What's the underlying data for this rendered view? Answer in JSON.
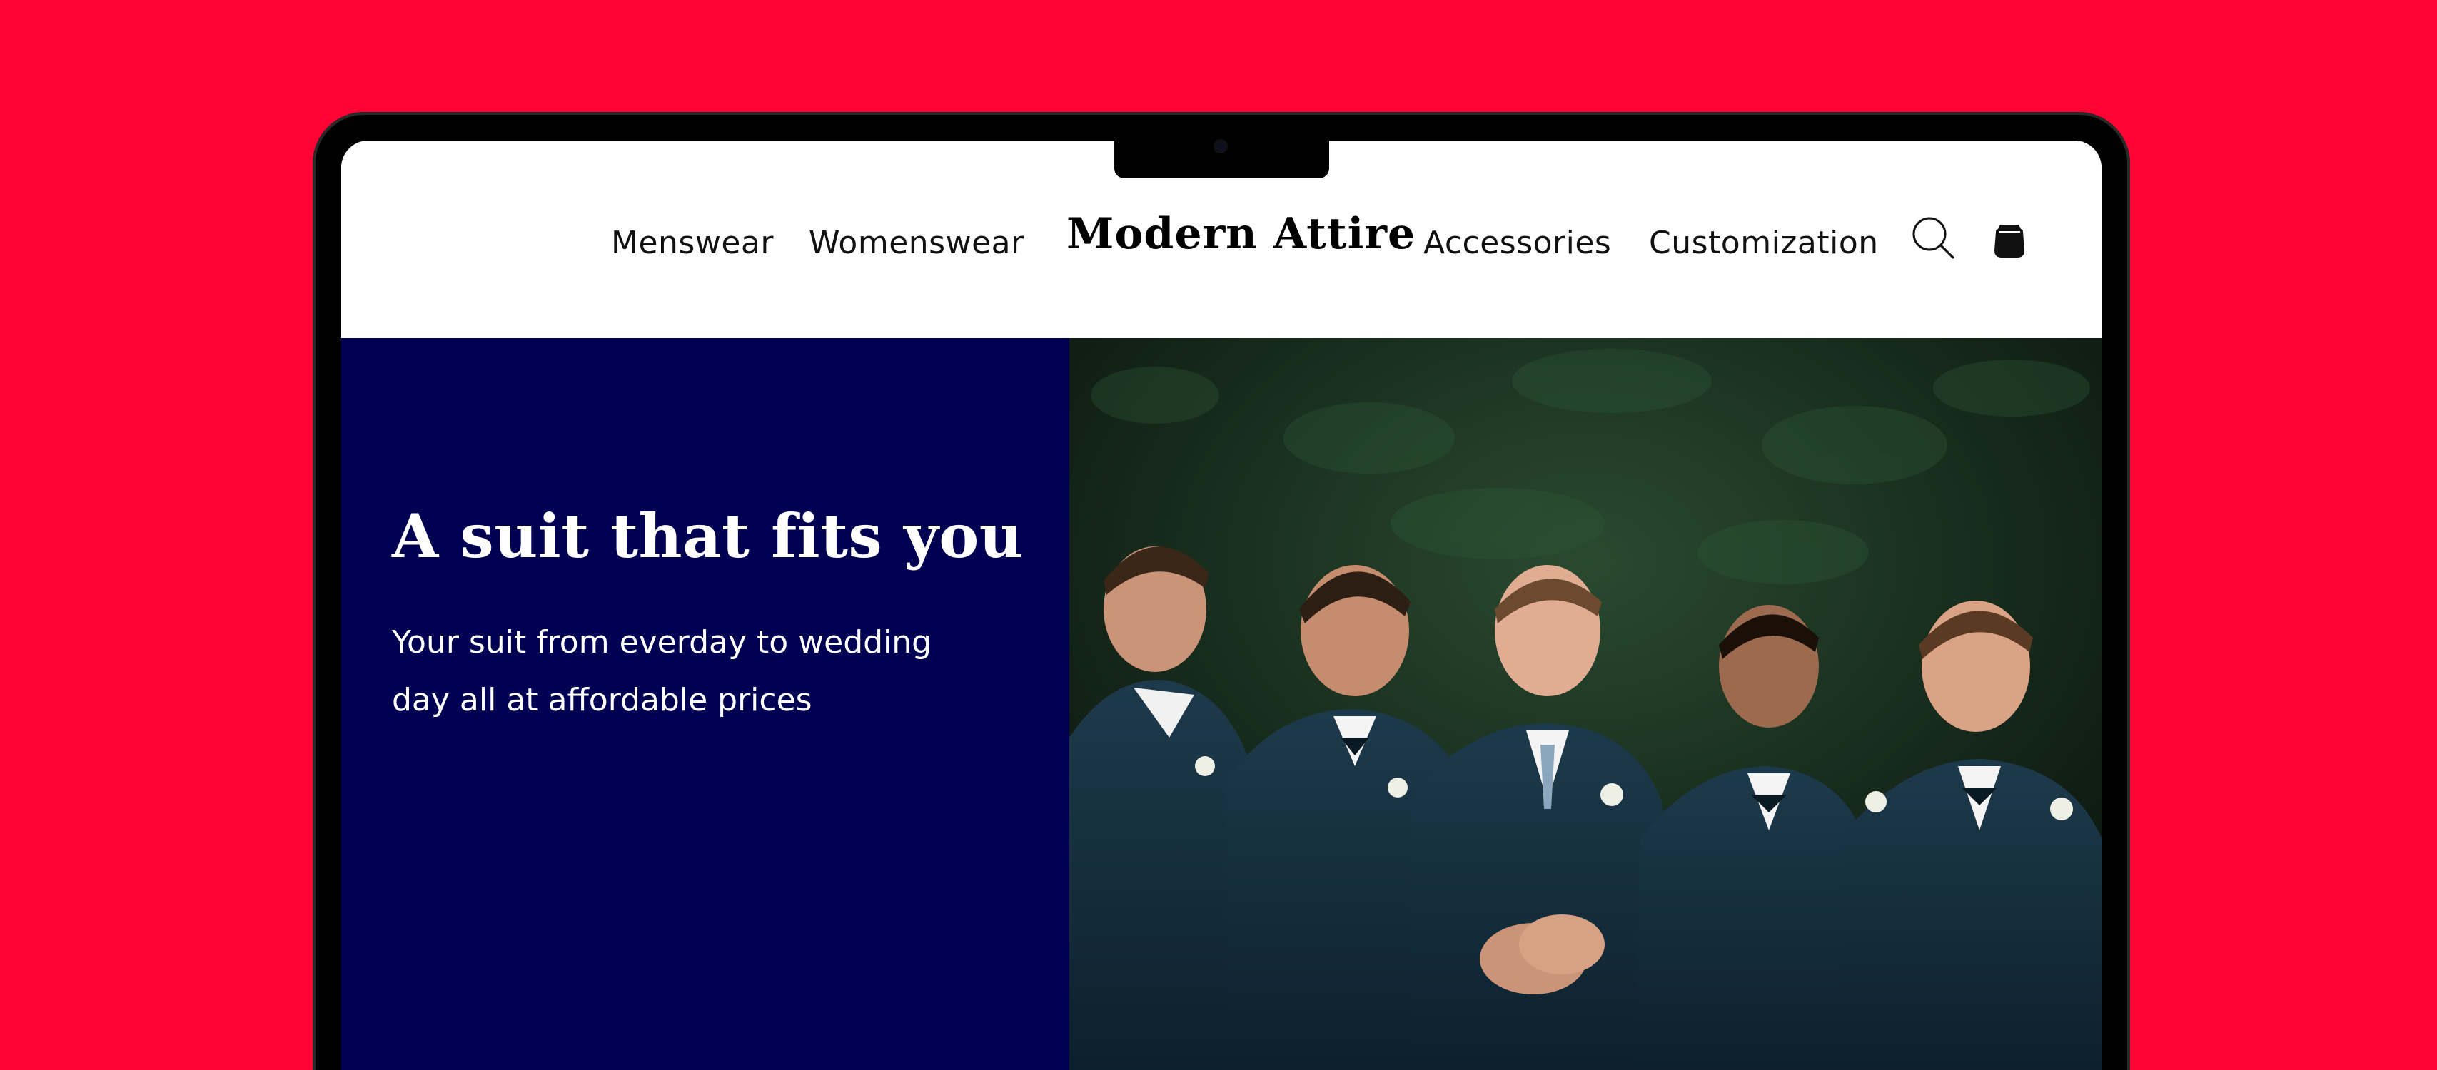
{
  "colors": {
    "page_background": "#FF0335",
    "hero_panel": "#000052",
    "header_background": "#FFFFFF",
    "text_dark": "#111111",
    "text_light": "#FFFFFF"
  },
  "header": {
    "nav_left": [
      "Menswear",
      "Womenswear"
    ],
    "brand": "Modern Attire",
    "nav_right": [
      "Accessories",
      "Customization"
    ],
    "icons": [
      "search-icon",
      "shopping-bag-icon"
    ]
  },
  "hero": {
    "title": "A suit that fits you",
    "subtitle_line1": "Your suit from everday to wedding",
    "subtitle_line2": "day all at affordable prices",
    "image": "photo of five groomsmen in navy suits and bow ties joining hands and laughing"
  }
}
